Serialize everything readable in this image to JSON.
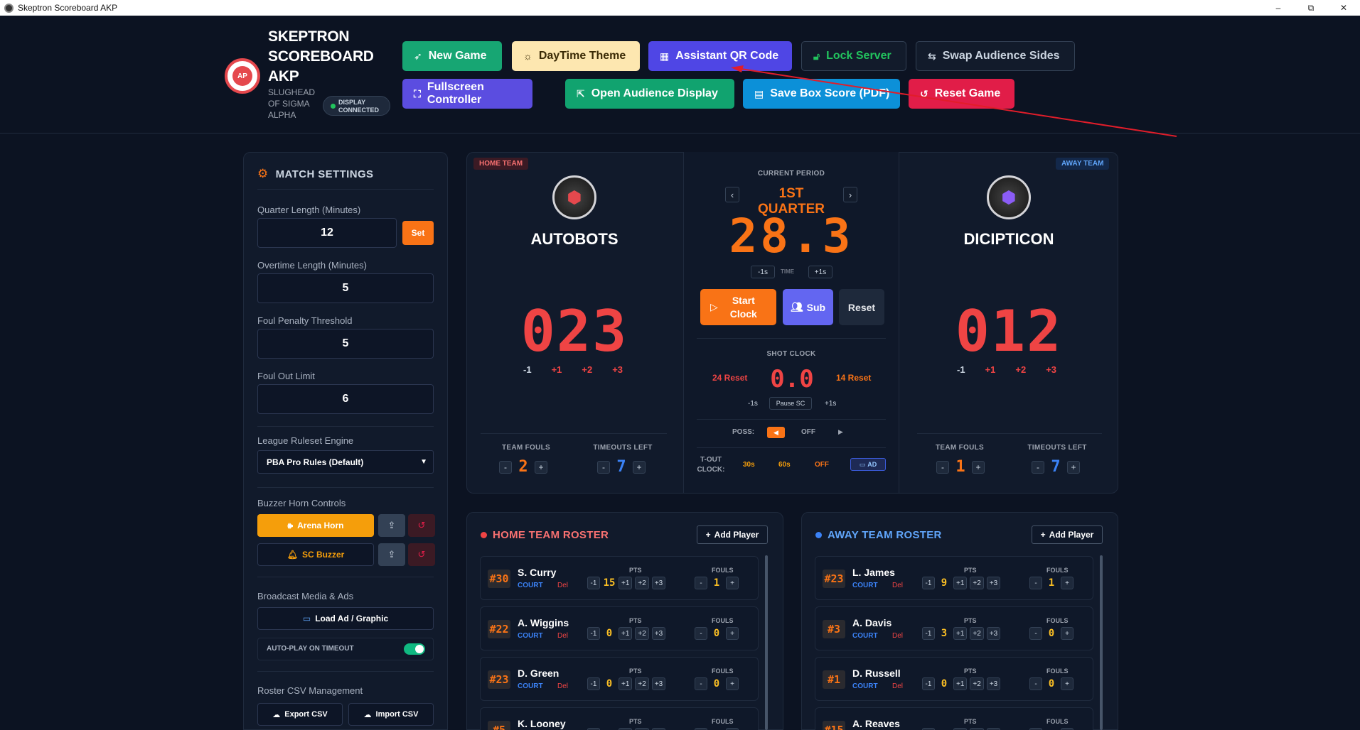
{
  "window": {
    "title": "Skeptron Scoreboard AKP",
    "minimize": "–",
    "maximize": "⧉",
    "close": "✕"
  },
  "header": {
    "app_title": "SKEPTRON SCOREBOARD AKP",
    "app_subtitle": "SLUGHEAD OF SIGMA ALPHA",
    "logo_text": "AP",
    "display_status": "DISPLAY CONNECTED",
    "buttons": {
      "new_game": "New Game",
      "theme": "DayTime Theme",
      "qr": "Assistant QR Code",
      "lock": "Lock Server",
      "swap": "Swap Audience Sides",
      "fullscreen": "Fullscreen Controller",
      "audience": "Open Audience Display",
      "boxscore": "Save Box Score (PDF)",
      "reset": "Reset Game"
    }
  },
  "settings": {
    "title": "MATCH SETTINGS",
    "quarter_label": "Quarter Length (Minutes)",
    "quarter_value": "12",
    "set_label": "Set",
    "ot_label": "Overtime Length (Minutes)",
    "ot_value": "5",
    "foul_penalty_label": "Foul Penalty Threshold",
    "foul_penalty_value": "5",
    "foul_out_label": "Foul Out Limit",
    "foul_out_value": "6",
    "ruleset_label": "League Ruleset Engine",
    "ruleset_value": "PBA Pro Rules (Default)",
    "buzzer_label": "Buzzer Horn Controls",
    "arena_horn": "Arena Horn",
    "sc_buzzer": "SC Buzzer",
    "media_label": "Broadcast Media & Ads",
    "load_ad": "Load Ad / Graphic",
    "autoplay_label": "AUTO-PLAY ON TIMEOUT",
    "autoplay_on": true,
    "csv_label": "Roster CSV Management",
    "export_csv": "Export CSV",
    "import_csv": "Import CSV"
  },
  "home": {
    "badge": "HOME TEAM",
    "name": "AUTOBOTS",
    "score": "023",
    "adj": [
      "-1",
      "+1",
      "+2",
      "+3"
    ],
    "fouls_label": "TEAM FOULS",
    "fouls": "2",
    "timeouts_label": "TIMEOUTS LEFT",
    "timeouts": "7"
  },
  "away": {
    "badge": "AWAY TEAM",
    "name": "DICIPTICON",
    "score": "012",
    "adj": [
      "-1",
      "+1",
      "+2",
      "+3"
    ],
    "fouls_label": "TEAM FOULS",
    "fouls": "1",
    "timeouts_label": "TIMEOUTS LEFT",
    "timeouts": "7"
  },
  "clock": {
    "period_label": "CURRENT PERIOD",
    "period": "1ST QUARTER",
    "time": "28.3",
    "minus": "-1s",
    "time_label": "TIME",
    "plus": "+1s",
    "start": "Start Clock",
    "sub": "Sub",
    "reset": "Reset",
    "shot_label": "SHOT CLOCK",
    "shot_value": "0.0",
    "reset24": "24 Reset",
    "reset14": "14 Reset",
    "sc_minus": "-1s",
    "pause_sc": "Pause SC",
    "sc_plus": "+1s",
    "poss_label": "POSS:",
    "poss_left": "◀",
    "poss_off": "OFF",
    "poss_right": "▶",
    "tout_label": "T-OUT CLOCK:",
    "t30": "30s",
    "t60": "60s",
    "toff": "OFF",
    "tad": "AD"
  },
  "home_roster": {
    "title": "HOME TEAM ROSTER",
    "add": "Add Player",
    "players": [
      {
        "num": "#30",
        "name": "S. Curry",
        "pts": "15",
        "fouls": "1"
      },
      {
        "num": "#22",
        "name": "A. Wiggins",
        "pts": "0",
        "fouls": "0"
      },
      {
        "num": "#23",
        "name": "D. Green",
        "pts": "0",
        "fouls": "0"
      },
      {
        "num": "#5",
        "name": "K. Looney",
        "pts": "",
        "fouls": ""
      }
    ]
  },
  "away_roster": {
    "title": "AWAY TEAM ROSTER",
    "add": "Add Player",
    "players": [
      {
        "num": "#23",
        "name": "L. James",
        "pts": "9",
        "fouls": "1"
      },
      {
        "num": "#3",
        "name": "A. Davis",
        "pts": "3",
        "fouls": "0"
      },
      {
        "num": "#1",
        "name": "D. Russell",
        "pts": "0",
        "fouls": "0"
      },
      {
        "num": "#15",
        "name": "A. Reaves",
        "pts": "",
        "fouls": ""
      }
    ]
  },
  "row_labels": {
    "court": "COURT",
    "del": "Del",
    "pts": "PTS",
    "fouls": "FOULS",
    "m1": "-1",
    "p1": "+1",
    "p2": "+2",
    "p3": "+3",
    "minus": "-",
    "plus": "+"
  },
  "colors": {
    "bg": "#0c1322",
    "accent_orange": "#f97316",
    "score_red": "#ef4444",
    "indigo": "#4f46e5",
    "away_blue": "#3b82f6"
  }
}
